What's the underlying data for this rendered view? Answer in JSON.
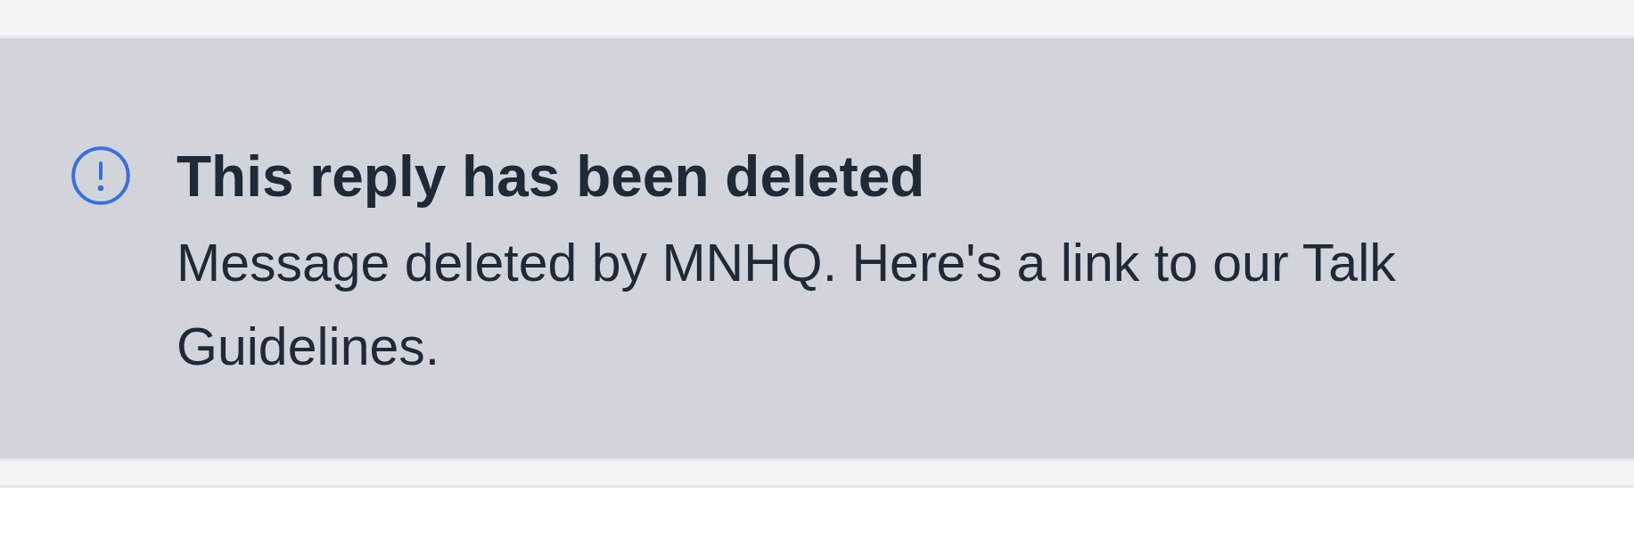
{
  "notice": {
    "title": "This reply has been deleted",
    "message": "Message deleted by MNHQ. Here's a link to our Talk Guidelines."
  }
}
